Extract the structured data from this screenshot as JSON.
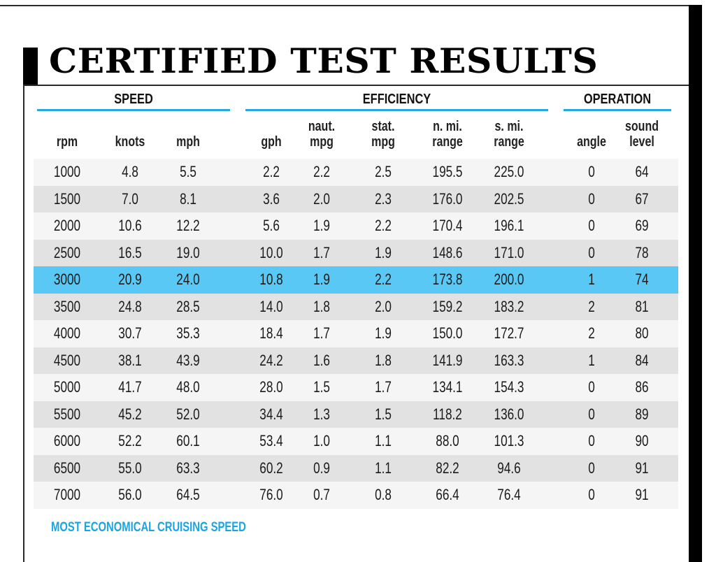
{
  "title": "CERTIFIED TEST RESULTS",
  "colors": {
    "accent_blue": "#29a8e0",
    "highlight_row": "#5ac8f5",
    "row_light": "#f5f5f5",
    "row_dark": "#e2e2e2",
    "footnote": "#1aa4e4"
  },
  "groups": {
    "speed": "SPEED",
    "efficiency": "EFFICIENCY",
    "operation": "OPERATION"
  },
  "columns": [
    {
      "key": "rpm",
      "line1": "",
      "line2": "rpm"
    },
    {
      "key": "knots",
      "line1": "",
      "line2": "knots"
    },
    {
      "key": "mph",
      "line1": "",
      "line2": "mph"
    },
    {
      "key": "gph",
      "line1": "",
      "line2": "gph"
    },
    {
      "key": "naut_mpg",
      "line1": "naut.",
      "line2": "mpg"
    },
    {
      "key": "stat_mpg",
      "line1": "stat.",
      "line2": "mpg"
    },
    {
      "key": "nmi_range",
      "line1": "n. mi.",
      "line2": "range"
    },
    {
      "key": "smi_range",
      "line1": "s. mi.",
      "line2": "range"
    },
    {
      "key": "angle",
      "line1": "",
      "line2": "angle"
    },
    {
      "key": "sound_level",
      "line1": "sound",
      "line2": "level"
    }
  ],
  "rows": [
    [
      "1000",
      "4.8",
      "5.5",
      "2.2",
      "2.2",
      "2.5",
      "195.5",
      "225.0",
      "0",
      "64"
    ],
    [
      "1500",
      "7.0",
      "8.1",
      "3.6",
      "2.0",
      "2.3",
      "176.0",
      "202.5",
      "0",
      "67"
    ],
    [
      "2000",
      "10.6",
      "12.2",
      "5.6",
      "1.9",
      "2.2",
      "170.4",
      "196.1",
      "0",
      "69"
    ],
    [
      "2500",
      "16.5",
      "19.0",
      "10.0",
      "1.7",
      "1.9",
      "148.6",
      "171.0",
      "0",
      "78"
    ],
    [
      "3000",
      "20.9",
      "24.0",
      "10.8",
      "1.9",
      "2.2",
      "173.8",
      "200.0",
      "1",
      "74"
    ],
    [
      "3500",
      "24.8",
      "28.5",
      "14.0",
      "1.8",
      "2.0",
      "159.2",
      "183.2",
      "2",
      "81"
    ],
    [
      "4000",
      "30.7",
      "35.3",
      "18.4",
      "1.7",
      "1.9",
      "150.0",
      "172.7",
      "2",
      "80"
    ],
    [
      "4500",
      "38.1",
      "43.9",
      "24.2",
      "1.6",
      "1.8",
      "141.9",
      "163.3",
      "1",
      "84"
    ],
    [
      "5000",
      "41.7",
      "48.0",
      "28.0",
      "1.5",
      "1.7",
      "134.1",
      "154.3",
      "0",
      "86"
    ],
    [
      "5500",
      "45.2",
      "52.0",
      "34.4",
      "1.3",
      "1.5",
      "118.2",
      "136.0",
      "0",
      "89"
    ],
    [
      "6000",
      "52.2",
      "60.1",
      "53.4",
      "1.0",
      "1.1",
      "88.0",
      "101.3",
      "0",
      "90"
    ],
    [
      "6500",
      "55.0",
      "63.3",
      "60.2",
      "0.9",
      "1.1",
      "82.2",
      "94.6",
      "0",
      "91"
    ],
    [
      "7000",
      "56.0",
      "64.5",
      "76.0",
      "0.7",
      "0.8",
      "66.4",
      "76.4",
      "0",
      "91"
    ]
  ],
  "highlighted_row_index": 4,
  "footnote": "MOST ECONOMICAL CRUISING SPEED"
}
